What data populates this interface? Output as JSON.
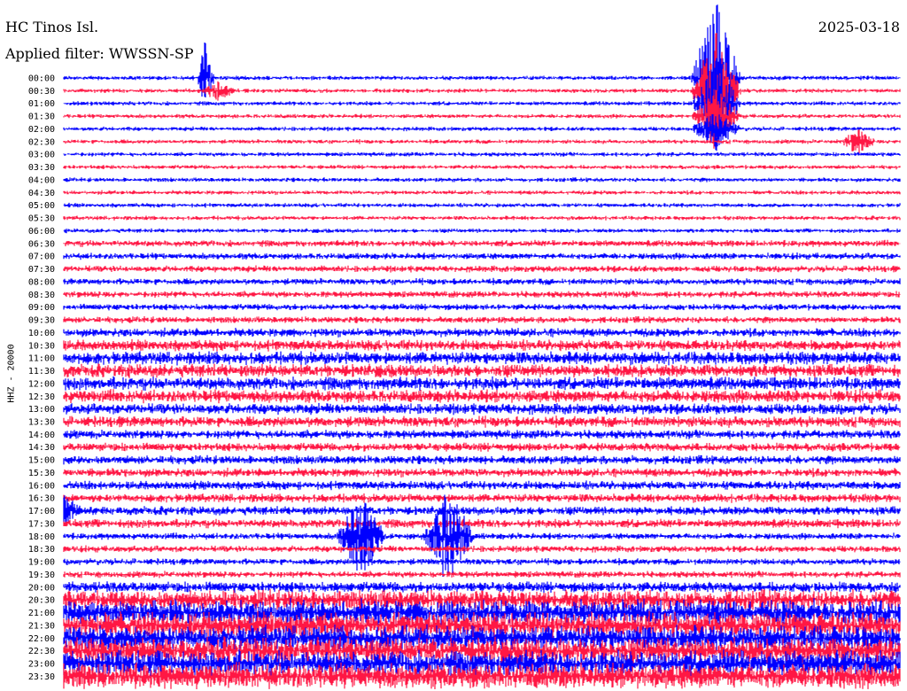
{
  "header": {
    "station": "HC Tinos Isl.",
    "filter": "Applied filter: WWSSN-SP",
    "date": "2025-03-18"
  },
  "chart_data": {
    "type": "line",
    "ylabel": "HHZ - 20000",
    "colors": {
      "even": "#0000ff",
      "odd": "#ff1744"
    },
    "row_labels": [
      "00:00",
      "00:30",
      "01:00",
      "01:30",
      "02:00",
      "02:30",
      "03:00",
      "03:30",
      "04:00",
      "04:30",
      "05:00",
      "05:30",
      "06:00",
      "06:30",
      "07:00",
      "07:30",
      "08:00",
      "08:30",
      "09:00",
      "09:30",
      "10:00",
      "10:30",
      "11:00",
      "11:30",
      "12:00",
      "12:30",
      "13:00",
      "13:30",
      "14:00",
      "14:30",
      "15:00",
      "15:30",
      "16:00",
      "16:30",
      "17:00",
      "17:30",
      "18:00",
      "18:30",
      "19:00",
      "19:30",
      "20:00",
      "20:30",
      "21:00",
      "21:30",
      "22:00",
      "22:30",
      "23:00",
      "23:30"
    ],
    "noise_level": [
      2,
      2,
      2,
      2,
      2,
      2,
      2,
      2,
      2,
      2,
      2,
      2,
      2,
      3,
      3,
      3,
      3,
      3,
      3,
      3,
      4,
      5,
      6,
      6,
      6,
      6,
      5,
      5,
      4,
      4,
      4,
      4,
      4,
      4,
      4,
      4,
      3,
      3,
      3,
      3,
      5,
      9,
      12,
      12,
      12,
      12,
      12,
      12
    ],
    "events": [
      {
        "row": 0,
        "pos": 0.17,
        "amp": 48,
        "len": 0.01
      },
      {
        "row": 1,
        "pos": 0.185,
        "amp": 10,
        "len": 0.02
      },
      {
        "row": 0,
        "pos": 0.78,
        "amp": 90,
        "len": 0.03
      },
      {
        "row": 1,
        "pos": 0.78,
        "amp": 70,
        "len": 0.03
      },
      {
        "row": 2,
        "pos": 0.78,
        "amp": 55,
        "len": 0.03
      },
      {
        "row": 3,
        "pos": 0.78,
        "amp": 30,
        "len": 0.03
      },
      {
        "row": 4,
        "pos": 0.78,
        "amp": 20,
        "len": 0.03
      },
      {
        "row": 5,
        "pos": 0.95,
        "amp": 14,
        "len": 0.02
      },
      {
        "row": 36,
        "pos": 0.355,
        "amp": 45,
        "len": 0.03
      },
      {
        "row": 36,
        "pos": 0.46,
        "amp": 55,
        "len": 0.03
      },
      {
        "row": 34,
        "pos": 0.0,
        "amp": 18,
        "len": 0.02
      }
    ]
  }
}
